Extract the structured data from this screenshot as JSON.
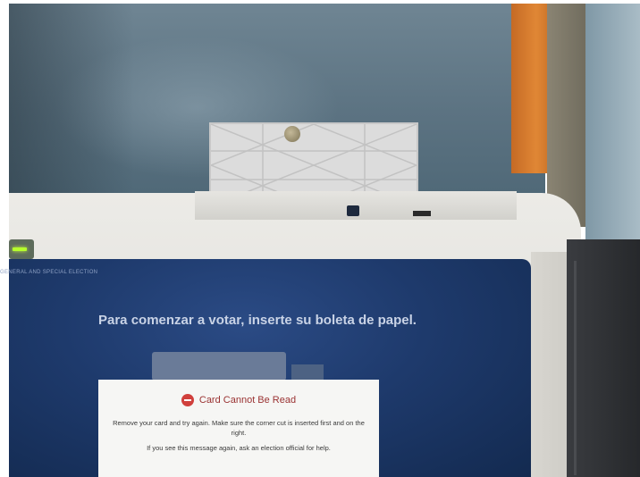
{
  "screen": {
    "header": "GENERAL AND SPECIAL ELECTION",
    "prompt": "Para comenzar a votar, inserte su boleta de papel."
  },
  "dialog": {
    "icon": "stop-icon",
    "title": "Card Cannot Be Read",
    "line1": "Remove your card and try again. Make sure the corner cut is inserted first and on the right.",
    "line2": "If you see this message again, ask an election official for help."
  },
  "colors": {
    "screen_bg": "#1e3a6c",
    "dialog_title": "#9a3232",
    "stop_icon": "#d0403c",
    "status_light": "#b6ff2c"
  }
}
